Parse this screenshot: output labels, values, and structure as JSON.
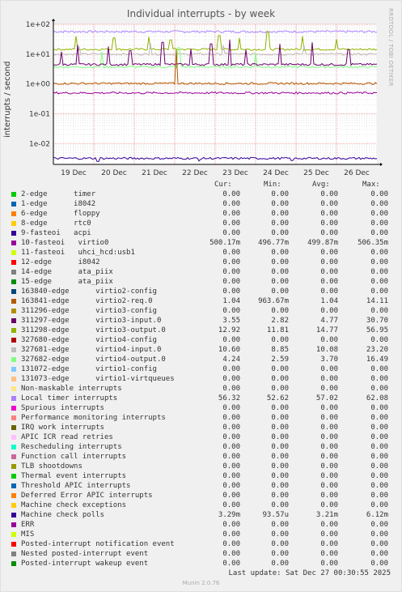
{
  "header": {
    "title": "Individual interrupts - by week",
    "ylabel": "interrupts / second",
    "watermark": "RRDTOOL / TOBI OETIKER"
  },
  "columns": {
    "cur": "Cur:",
    "min": "Min:",
    "avg": "Avg:",
    "max": "Max:"
  },
  "legend": [
    {
      "name": "2-edge      timer",
      "color": "#00cc00",
      "cur": "0.00",
      "min": "0.00",
      "avg": "0.00",
      "max": "0.00"
    },
    {
      "name": "1-edge      i8042",
      "color": "#0066b3",
      "cur": "0.00",
      "min": "0.00",
      "avg": "0.00",
      "max": "0.00"
    },
    {
      "name": "6-edge      floppy",
      "color": "#ff8000",
      "cur": "0.00",
      "min": "0.00",
      "avg": "0.00",
      "max": "0.00"
    },
    {
      "name": "8-edge      rtc0",
      "color": "#ffcc00",
      "cur": "0.00",
      "min": "0.00",
      "avg": "0.00",
      "max": "0.00"
    },
    {
      "name": "9-fasteoi   acpi",
      "color": "#330099",
      "cur": "0.00",
      "min": "0.00",
      "avg": "0.00",
      "max": "0.00"
    },
    {
      "name": "10-fasteoi   virtio0",
      "color": "#990099",
      "cur": "500.17m",
      "min": "496.77m",
      "avg": "499.87m",
      "max": "506.35m"
    },
    {
      "name": "11-fasteoi   uhci_hcd:usb1",
      "color": "#ccff00",
      "cur": "0.00",
      "min": "0.00",
      "avg": "0.00",
      "max": "0.00"
    },
    {
      "name": "12-edge      i8042",
      "color": "#ff0000",
      "cur": "0.00",
      "min": "0.00",
      "avg": "0.00",
      "max": "0.00"
    },
    {
      "name": "14-edge      ata_piix",
      "color": "#808080",
      "cur": "0.00",
      "min": "0.00",
      "avg": "0.00",
      "max": "0.00"
    },
    {
      "name": "15-edge      ata_piix",
      "color": "#008f00",
      "cur": "0.00",
      "min": "0.00",
      "avg": "0.00",
      "max": "0.00"
    },
    {
      "name": "163840-edge      virtio2-config",
      "color": "#00487d",
      "cur": "0.00",
      "min": "0.00",
      "avg": "0.00",
      "max": "0.00"
    },
    {
      "name": "163841-edge      virtio2-req.0",
      "color": "#b35a00",
      "cur": "1.04",
      "min": "963.67m",
      "avg": "1.04",
      "max": "14.11"
    },
    {
      "name": "311296-edge      virtio3-config",
      "color": "#b38f00",
      "cur": "0.00",
      "min": "0.00",
      "avg": "0.00",
      "max": "0.00"
    },
    {
      "name": "311297-edge      virtio3-input.0",
      "color": "#6b006b",
      "cur": "3.55",
      "min": "2.82",
      "avg": "4.77",
      "max": "30.70"
    },
    {
      "name": "311298-edge      virtio3-output.0",
      "color": "#8fb300",
      "cur": "12.92",
      "min": "11.81",
      "avg": "14.77",
      "max": "56.95"
    },
    {
      "name": "327680-edge      virtio4-config",
      "color": "#b30000",
      "cur": "0.00",
      "min": "0.00",
      "avg": "0.00",
      "max": "0.00"
    },
    {
      "name": "327681-edge      virtio4-input.0",
      "color": "#bebebe",
      "cur": "10.60",
      "min": "8.85",
      "avg": "10.08",
      "max": "23.20"
    },
    {
      "name": "327682-edge      virtio4-output.0",
      "color": "#80ff80",
      "cur": "4.24",
      "min": "2.59",
      "avg": "3.70",
      "max": "16.49"
    },
    {
      "name": "131072-edge      virtio1-config",
      "color": "#80c9ff",
      "cur": "0.00",
      "min": "0.00",
      "avg": "0.00",
      "max": "0.00"
    },
    {
      "name": "131073-edge      virtio1-virtqueues",
      "color": "#ffc080",
      "cur": "0.00",
      "min": "0.00",
      "avg": "0.00",
      "max": "0.00"
    },
    {
      "name": "Non-maskable interrupts",
      "color": "#ffe680",
      "cur": "0.00",
      "min": "0.00",
      "avg": "0.00",
      "max": "0.00"
    },
    {
      "name": "Local timer interrupts",
      "color": "#aa80ff",
      "cur": "56.32",
      "min": "52.62",
      "avg": "57.02",
      "max": "62.08"
    },
    {
      "name": "Spurious interrupts",
      "color": "#ee00cc",
      "cur": "0.00",
      "min": "0.00",
      "avg": "0.00",
      "max": "0.00"
    },
    {
      "name": "Performance monitoring interrupts",
      "color": "#ff8080",
      "cur": "0.00",
      "min": "0.00",
      "avg": "0.00",
      "max": "0.00"
    },
    {
      "name": "IRQ work interrupts",
      "color": "#666600",
      "cur": "0.00",
      "min": "0.00",
      "avg": "0.00",
      "max": "0.00"
    },
    {
      "name": "APIC ICR read retries",
      "color": "#ffbfff",
      "cur": "0.00",
      "min": "0.00",
      "avg": "0.00",
      "max": "0.00"
    },
    {
      "name": "Rescheduling interrupts",
      "color": "#00ffcc",
      "cur": "0.00",
      "min": "0.00",
      "avg": "0.00",
      "max": "0.00"
    },
    {
      "name": "Function call interrupts",
      "color": "#cc6699",
      "cur": "0.00",
      "min": "0.00",
      "avg": "0.00",
      "max": "0.00"
    },
    {
      "name": "TLB shootdowns",
      "color": "#999900",
      "cur": "0.00",
      "min": "0.00",
      "avg": "0.00",
      "max": "0.00"
    },
    {
      "name": "Thermal event interrupts",
      "color": "#00cc00",
      "cur": "0.00",
      "min": "0.00",
      "avg": "0.00",
      "max": "0.00"
    },
    {
      "name": "Threshold APIC interrupts",
      "color": "#0066b3",
      "cur": "0.00",
      "min": "0.00",
      "avg": "0.00",
      "max": "0.00"
    },
    {
      "name": "Deferred Error APIC interrupts",
      "color": "#ff8000",
      "cur": "0.00",
      "min": "0.00",
      "avg": "0.00",
      "max": "0.00"
    },
    {
      "name": "Machine check exceptions",
      "color": "#ffcc00",
      "cur": "0.00",
      "min": "0.00",
      "avg": "0.00",
      "max": "0.00"
    },
    {
      "name": "Machine check polls",
      "color": "#330099",
      "cur": "3.29m",
      "min": "93.57u",
      "avg": "3.21m",
      "max": "6.12m"
    },
    {
      "name": "ERR",
      "color": "#990099",
      "cur": "0.00",
      "min": "0.00",
      "avg": "0.00",
      "max": "0.00"
    },
    {
      "name": "MIS",
      "color": "#ccff00",
      "cur": "0.00",
      "min": "0.00",
      "avg": "0.00",
      "max": "0.00"
    },
    {
      "name": "Posted-interrupt notification event",
      "color": "#ff0000",
      "cur": "0.00",
      "min": "0.00",
      "avg": "0.00",
      "max": "0.00"
    },
    {
      "name": "Nested posted-interrupt event",
      "color": "#808080",
      "cur": "0.00",
      "min": "0.00",
      "avg": "0.00",
      "max": "0.00"
    },
    {
      "name": "Posted-interrupt wakeup event",
      "color": "#008f00",
      "cur": "0.00",
      "min": "0.00",
      "avg": "0.00",
      "max": "0.00"
    }
  ],
  "footer": {
    "last_update": "Last update: Sat Dec 27 00:30:55 2025",
    "munin": "Munin 2.0.76"
  },
  "chart_data": {
    "type": "line",
    "yscale": "log",
    "ylim": [
      0.002,
      100
    ],
    "yticks": [
      "1e-02",
      "1e-01",
      "1e+00",
      "1e+01",
      "1e+02"
    ],
    "ytick_values": [
      0.01,
      0.1,
      1,
      10,
      100
    ],
    "xlim": [
      0,
      8
    ],
    "xticks": [
      "19 Dec",
      "20 Dec",
      "21 Dec",
      "22 Dec",
      "23 Dec",
      "24 Dec",
      "25 Dec",
      "26 Dec"
    ],
    "xtick_values": [
      0.5,
      1.5,
      2.5,
      3.5,
      4.5,
      5.5,
      6.5,
      7.5
    ],
    "grid": true,
    "series": [
      {
        "name": "Local timer interrupts",
        "color": "#aa80ff",
        "base": 57,
        "spikes": []
      },
      {
        "name": "311298-edge virtio3-output.0",
        "color": "#8fb300",
        "base": 14.5,
        "spikes": [
          [
            0.55,
            40
          ],
          [
            1.5,
            35
          ],
          [
            2.35,
            38
          ],
          [
            2.9,
            30
          ],
          [
            4.1,
            42
          ],
          [
            4.6,
            35
          ],
          [
            5.3,
            56.95
          ],
          [
            6.15,
            40
          ],
          [
            7.0,
            32
          ]
        ]
      },
      {
        "name": "327681-edge virtio4-input.0",
        "color": "#bebebe",
        "base": 10,
        "spikes": [
          [
            0.65,
            18
          ],
          [
            2.4,
            23.2
          ],
          [
            4.2,
            20
          ],
          [
            6.2,
            19
          ]
        ]
      },
      {
        "name": "327682-edge virtio4-output.0",
        "color": "#80ff80",
        "base": 3.7,
        "spikes": [
          [
            1.2,
            12
          ],
          [
            3.1,
            16.49
          ],
          [
            5.0,
            11
          ]
        ]
      },
      {
        "name": "311297-edge virtio3-input.0",
        "color": "#6b006b",
        "base": 4.5,
        "spikes": [
          [
            0.2,
            12
          ],
          [
            0.6,
            20
          ],
          [
            1.35,
            18
          ],
          [
            1.9,
            13
          ],
          [
            2.7,
            25
          ],
          [
            3.4,
            15
          ],
          [
            3.9,
            22
          ],
          [
            4.35,
            30.7
          ],
          [
            4.75,
            14
          ],
          [
            5.6,
            22
          ],
          [
            6.4,
            25
          ],
          [
            7.3,
            14
          ]
        ]
      },
      {
        "name": "163841-edge virtio2-req.0",
        "color": "#b35a00",
        "base": 1.04,
        "spikes": [
          [
            3.05,
            14.11
          ]
        ]
      },
      {
        "name": "10-fasteoi virtio0",
        "color": "#990099",
        "base": 0.5,
        "spikes": []
      },
      {
        "name": "Machine check polls",
        "color": "#330099",
        "base": 0.0032,
        "spikes": [
          [
            1.1,
            0.0025
          ],
          [
            3.6,
            0.0026
          ],
          [
            5.9,
            0.0027
          ]
        ]
      }
    ]
  }
}
